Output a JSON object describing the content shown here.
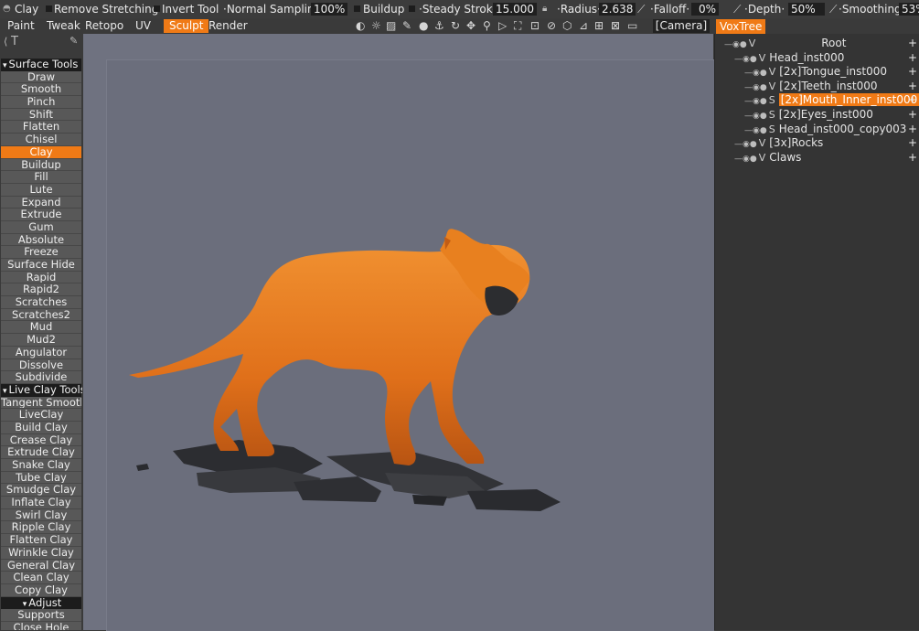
{
  "topbar": {
    "tool_name": "Clay",
    "remove_stretching": "Remove  Stretching",
    "invert_tool": "Invert  Tool",
    "sampling_label": "·Normal  Sampling·",
    "sampling_value": "100%",
    "buildup": "Buildup",
    "steady_stroke_label": "·Steady  Stroke·",
    "steady_stroke_value": "15.000",
    "radius_label": "·Radius·",
    "radius_value": "2.638",
    "falloff_label": "·Falloff·",
    "falloff_value": "0%",
    "depth_label": "·Depth·",
    "depth_value": "50%",
    "smoothing_label": "·Smoothing·",
    "smoothing_value": "53%"
  },
  "menu": {
    "tabs": [
      "Paint",
      "Tweak",
      "Retopo",
      "UV",
      "Sculpt",
      "Render"
    ],
    "active_tab": "Sculpt",
    "camera": "[Camera]",
    "voxtree": "VoxTree"
  },
  "left_panel": {
    "header_icon": "T",
    "sections": [
      {
        "title": "Surface  Tools",
        "items": [
          "Draw",
          "Smooth",
          "Pinch",
          "Shift",
          "Flatten",
          "Chisel",
          "Clay",
          "Buildup",
          "Fill",
          "Lute",
          "Expand",
          "Extrude",
          "Gum",
          "Absolute",
          "Freeze",
          "Surface  Hide",
          "Rapid",
          "Rapid2",
          "Scratches",
          "Scratches2",
          "Mud",
          "Mud2",
          "Angulator",
          "Dissolve",
          "Subdivide"
        ]
      },
      {
        "title": "Live  Clay  Tools",
        "items": [
          "Tangent  Smooth",
          "LiveClay",
          "Build  Clay",
          "Crease  Clay",
          "Extrude  Clay",
          "Snake  Clay",
          "Tube  Clay",
          "Smudge  Clay",
          "Inflate  Clay",
          "Swirl  Clay",
          "Ripple  Clay",
          "Flatten  Clay",
          "Wrinkle  Clay",
          "General  Clay",
          "Clean  Clay",
          "Copy  Clay"
        ]
      },
      {
        "title": "Adjust",
        "items": [
          "Supports",
          "Close  Hole"
        ]
      }
    ],
    "active_item": "Clay"
  },
  "voxtree": {
    "rows": [
      {
        "vs": "V",
        "name": "Root",
        "level": 0
      },
      {
        "vs": "V",
        "name": "Head_inst000",
        "level": 1
      },
      {
        "vs": "V",
        "name": "[2x]Tongue_inst000",
        "level": 2
      },
      {
        "vs": "V",
        "name": "[2x]Teeth_inst000",
        "level": 2
      },
      {
        "vs": "S",
        "name": "[2x]Mouth_Inner_inst000",
        "level": 2,
        "selected": true
      },
      {
        "vs": "S",
        "name": "[2x]Eyes_inst000",
        "level": 2
      },
      {
        "vs": "S",
        "name": "Head_inst000_copy003",
        "level": 2
      },
      {
        "vs": "V",
        "name": "[3x]Rocks",
        "level": 1
      },
      {
        "vs": "V",
        "name": "Claws",
        "level": 1
      }
    ],
    "plus_label": "+"
  },
  "colors": {
    "accent": "#f07a16",
    "viewport": "#6b6e7c",
    "model": "#e8741c"
  }
}
